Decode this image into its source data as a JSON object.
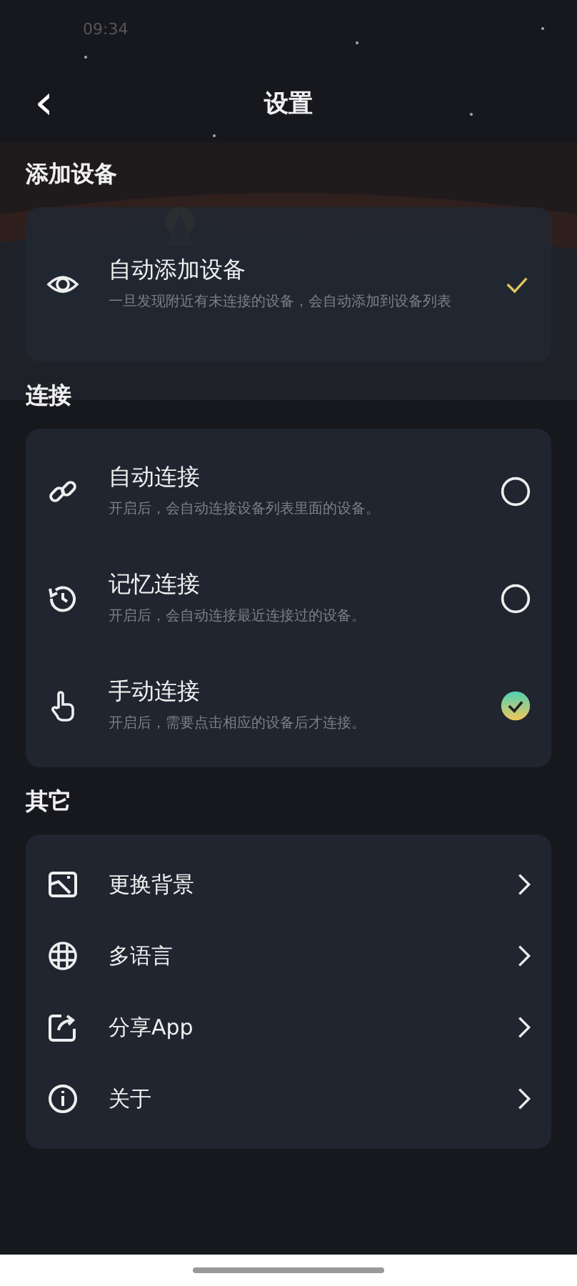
{
  "status_bar": {
    "time": "09:34"
  },
  "header": {
    "back": "‹",
    "title": "设置"
  },
  "add_device": {
    "heading": "添加设备",
    "item": {
      "title": "自动添加设备",
      "description": "一旦发现附近有未连接的设备，会自动添加到设备列表",
      "checked": true
    }
  },
  "connection": {
    "heading": "连接",
    "options": [
      {
        "title": "自动连接",
        "description": "开启后，会自动连接设备列表里面的设备。",
        "selected": false
      },
      {
        "title": "记忆连接",
        "description": "开启后，会自动连接最近连接过的设备。",
        "selected": false
      },
      {
        "title": "手动连接",
        "description": "开启后，需要点击相应的设备后才连接。",
        "selected": true
      }
    ]
  },
  "other": {
    "heading": "其它",
    "items": [
      {
        "label": "更换背景"
      },
      {
        "label": "多语言"
      },
      {
        "label": "分享App"
      },
      {
        "label": "关于"
      }
    ]
  }
}
